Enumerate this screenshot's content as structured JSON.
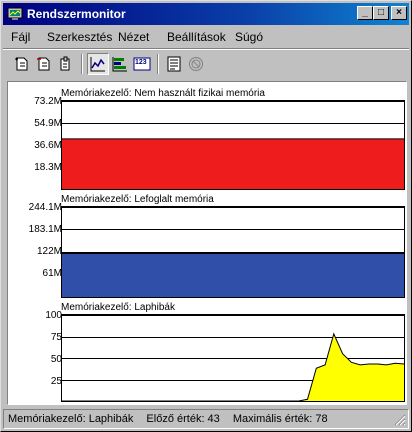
{
  "window": {
    "title": "Rendszermonitor",
    "controls": {
      "minimize": "_",
      "maximize": "□",
      "close": "×"
    }
  },
  "menu": {
    "items": [
      "Fájl",
      "Szerkesztés",
      "Nézet",
      "Beállítások",
      "Súgó"
    ]
  },
  "toolbar": {
    "buttons": [
      {
        "icon": "add-item-icon"
      },
      {
        "icon": "remove-item-icon"
      },
      {
        "icon": "edit-item-icon"
      },
      {
        "icon": "line-chart-icon",
        "pressed": true
      },
      {
        "icon": "bar-chart-icon"
      },
      {
        "icon": "numeric-view-icon",
        "label": "123"
      },
      {
        "icon": "properties-icon"
      },
      {
        "icon": "stop-icon"
      }
    ]
  },
  "chart_data": [
    {
      "type": "area",
      "title": "Memóriakezelő: Nem használt fizikai memória",
      "y_ticks": [
        "73.2M",
        "54.9M",
        "36.6M",
        "18.3M"
      ],
      "y_tick_values": [
        73.2,
        54.9,
        36.6,
        18.3
      ],
      "ylim": [
        0,
        73.2
      ],
      "unit": "MB",
      "color": "#ee1c1c",
      "values": [
        41.7,
        41.7,
        41.7,
        41.7,
        41.7,
        41.7,
        41.7,
        41.7,
        41.7,
        41.7,
        41.7,
        41.7,
        41.7,
        41.7,
        41.7,
        41.7,
        41.7,
        41.7,
        41.7,
        41.7,
        41.7,
        41.7,
        41.7,
        41.7,
        41.7,
        41.7,
        41.7,
        41.7,
        41.7,
        41.7,
        41.7,
        41.7,
        41.7,
        41.7,
        41.7,
        41.7,
        41.7,
        41.7,
        41.7,
        41.7
      ]
    },
    {
      "type": "area",
      "title": "Memóriakezelő: Lefoglalt memória",
      "y_ticks": [
        "244.1M",
        "183.1M",
        "122M",
        "61M"
      ],
      "y_tick_values": [
        244.1,
        183.1,
        122,
        61
      ],
      "ylim": [
        0,
        244.1
      ],
      "unit": "MB",
      "color": "#2f4fa8",
      "values": [
        118,
        118,
        118,
        118,
        118,
        118,
        118,
        118,
        118,
        118,
        118,
        118,
        118,
        118,
        118,
        118,
        118,
        118,
        118,
        118,
        118,
        118,
        118,
        118,
        118,
        118,
        118,
        118,
        118,
        118,
        118,
        118,
        118,
        118,
        118,
        118,
        118,
        118,
        118,
        118
      ]
    },
    {
      "type": "area",
      "title": "Memóriakezelő: Laphibák",
      "y_ticks": [
        "100",
        "75",
        "50",
        "25"
      ],
      "y_tick_values": [
        100,
        75,
        50,
        25
      ],
      "ylim": [
        0,
        100
      ],
      "color": "#ffff00",
      "values": [
        0,
        0,
        0,
        0,
        0,
        0,
        0,
        0,
        0,
        0,
        0,
        0,
        0,
        0,
        0,
        0,
        0,
        0,
        0,
        0,
        0,
        0,
        0,
        0,
        0,
        0,
        0,
        0,
        2,
        38,
        42,
        78,
        55,
        45,
        42,
        43,
        43,
        42,
        44,
        43
      ]
    }
  ],
  "statusbar": {
    "counter": "Memóriakezelő: Laphibák",
    "last_value": "Előző érték: 43",
    "max_value": "Maximális érték: 78"
  }
}
